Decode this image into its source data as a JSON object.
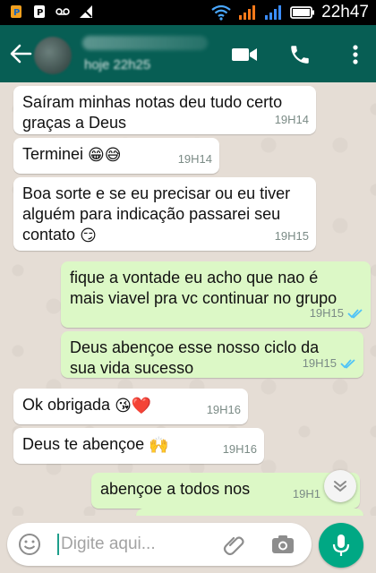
{
  "status_bar": {
    "time": "22h47",
    "icons": [
      "app-p-icon",
      "app-p2-icon",
      "voicemail-icon",
      "no-signal-icon",
      "wifi-icon",
      "signal-icon",
      "signal-icon-2",
      "battery-icon"
    ]
  },
  "header": {
    "last_seen": "hoje 22h25",
    "icons": [
      "back-arrow-icon",
      "video-call-icon",
      "phone-icon"
    ]
  },
  "messages": [
    {
      "direction": "in",
      "text": "Saíram minhas notas deu tudo certo graças a Deus",
      "time": "19H14"
    },
    {
      "direction": "in",
      "text": "Terminei",
      "emoji": "😁😅",
      "time": "19H14"
    },
    {
      "direction": "in",
      "text": "Boa sorte e se eu precisar ou eu tiver alguém para indicação passarei seu contato",
      "emoji": "😏",
      "time": "19H15"
    },
    {
      "direction": "out",
      "text": "fique a vontade eu acho que nao é mais viavel pra vc continuar no grupo",
      "time": "19H15"
    },
    {
      "direction": "out",
      "text": "Deus abençoe esse nosso ciclo da sua vida sucesso",
      "time": "19H15"
    },
    {
      "direction": "in",
      "text": "Ok obrigada",
      "emoji": "😘❤️",
      "time": "19H16"
    },
    {
      "direction": "in",
      "text": "Deus te abençoe",
      "emoji": "🙌",
      "time": "19H16"
    },
    {
      "direction": "out",
      "text": "abençoe a todos nos",
      "time": "19H1"
    }
  ],
  "input": {
    "placeholder": "Digite aqui..."
  },
  "colors": {
    "header": "#075e54",
    "outgoing_bubble": "#dcf8c6",
    "incoming_bubble": "#ffffff",
    "chat_bg": "#e5ddd5",
    "read_ticks": "#4fc3f7",
    "mic_button": "#00a884"
  }
}
